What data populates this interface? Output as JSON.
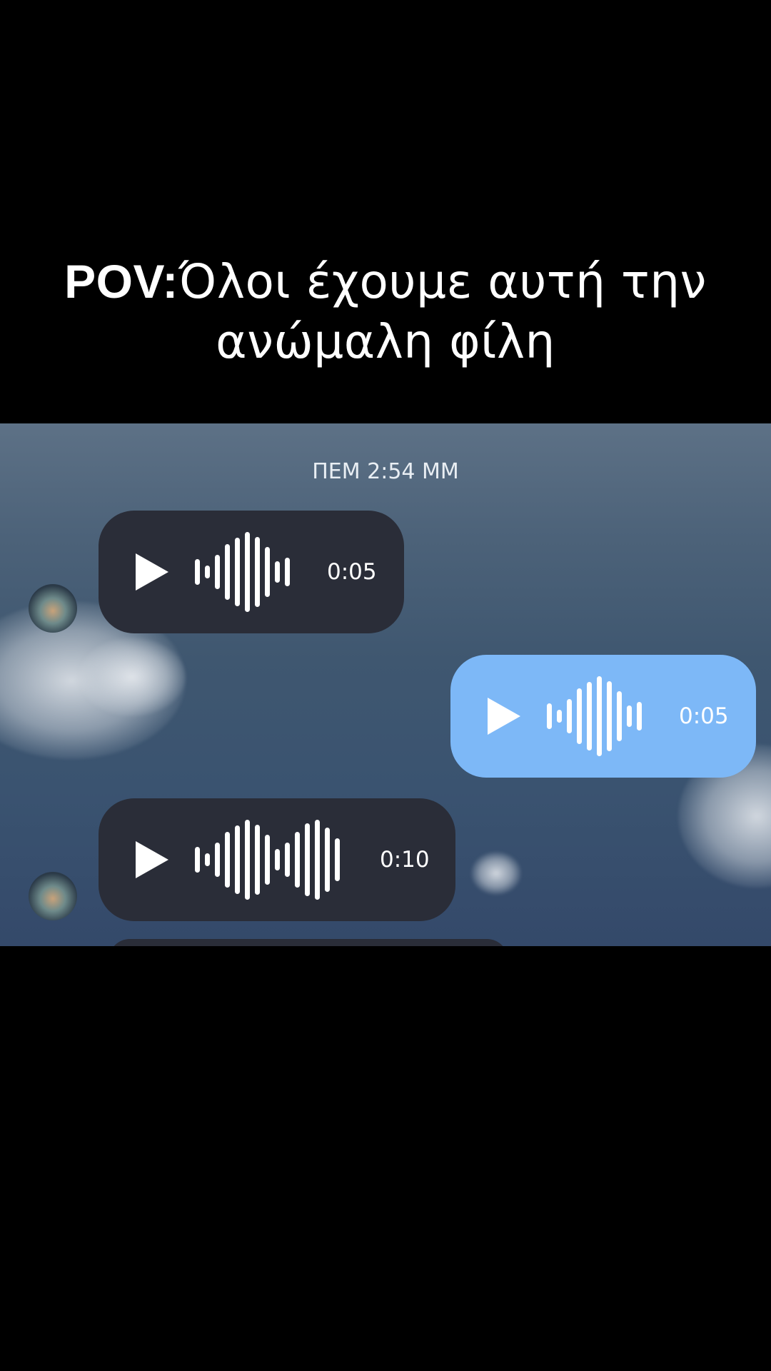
{
  "caption": {
    "bold": "POV:",
    "rest_line1": "Όλοι έχουμε αυτή την",
    "line2": "ανώμαλη φίλη"
  },
  "chat": {
    "timestamp": "ΠΕΜ 2:54 ΜΜ",
    "messages": [
      {
        "direction": "incoming",
        "type": "voice",
        "duration": "0:05"
      },
      {
        "direction": "outgoing",
        "type": "voice",
        "duration": "0:05"
      },
      {
        "direction": "incoming",
        "type": "voice",
        "duration": "0:10"
      }
    ]
  },
  "icons": {
    "play": "play-icon",
    "waveform": "waveform-icon",
    "avatar": "avatar"
  },
  "colors": {
    "incoming_bubble": "#2a2d38",
    "outgoing_bubble": "#7db8f7",
    "background": "#000000"
  }
}
